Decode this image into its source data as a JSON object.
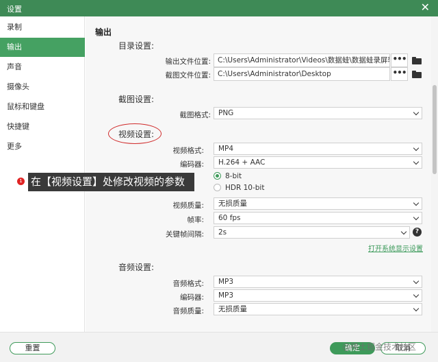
{
  "window": {
    "title": "设置",
    "close_glyph": "✕"
  },
  "sidebar": {
    "items": [
      {
        "label": "录制"
      },
      {
        "label": "输出"
      },
      {
        "label": "声音"
      },
      {
        "label": "摄像头"
      },
      {
        "label": "鼠标和键盘"
      },
      {
        "label": "快捷键"
      },
      {
        "label": "更多"
      }
    ],
    "active": "输出"
  },
  "output": {
    "heading": "输出",
    "directory": {
      "heading": "目录设置:",
      "output_folder_label": "输出文件位置:",
      "output_folder_value": "C:\\Users\\Administrator\\Videos\\数据蛙\\数据蛙录屏软件",
      "screenshot_folder_label": "截图文件位置:",
      "screenshot_folder_value": "C:\\Users\\Administrator\\Desktop",
      "browse_label": "•••"
    },
    "screenshot": {
      "heading": "截图设置:",
      "format_label": "截图格式:",
      "format_value": "PNG"
    },
    "video": {
      "heading": "视频设置:",
      "format_label": "视频格式:",
      "format_value": "MP4",
      "encoder_label": "编码器:",
      "encoder_value": "H.264 + AAC",
      "bitdepth_options": [
        "8-bit",
        "HDR 10-bit"
      ],
      "bitdepth_selected": "8-bit",
      "quality_label": "视频质量:",
      "quality_value": "无损质量",
      "fps_label": "帧率:",
      "fps_value": "60 fps",
      "keyframe_label": "关键帧间隔:",
      "keyframe_value": "2s",
      "help_glyph": "?",
      "system_display_link": "打开系统显示设置"
    },
    "audio": {
      "heading": "音频设置:",
      "format_label": "音频格式:",
      "format_value": "MP3",
      "encoder_label": "编码器:",
      "encoder_value": "MP3",
      "quality_label": "音频质量:",
      "quality_value": "无损质量"
    }
  },
  "annotation": {
    "badge": "1",
    "text": "在【视频设置】处修改视频的参数",
    "highlight_color": "#d02b2b"
  },
  "footer": {
    "reset_label": "重置",
    "ok_label": "确定",
    "cancel_label": "取消"
  },
  "watermark": "@稀土掘金技术社区",
  "colors": {
    "accent": "#45a162",
    "titlebar": "#3e8a56"
  }
}
